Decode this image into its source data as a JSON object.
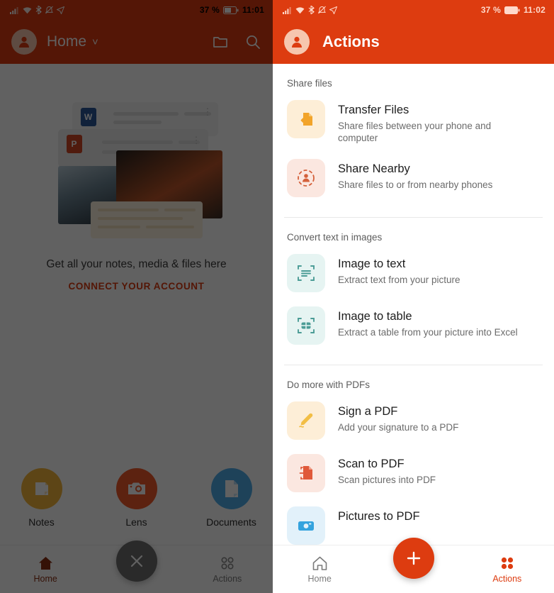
{
  "left": {
    "statusbar": {
      "battery_pct": "37 %",
      "time": "11:01",
      "icons": [
        "signal-icon",
        "wifi-icon",
        "bluetooth-icon",
        "mute-icon",
        "location-icon",
        "battery-icon"
      ]
    },
    "appbar": {
      "title": "Home",
      "chevron": "˅",
      "avatar_icon": "account-avatar-icon",
      "folder_icon": "folder-icon",
      "search_icon": "search-icon"
    },
    "empty": {
      "title": "Get all your notes, media & files here",
      "link": "CONNECT YOUR ACCOUNT",
      "illustration_icon": "files-illustration"
    },
    "quick_actions": [
      {
        "label": "Notes",
        "icon": "note-icon",
        "color": "#F5B53C"
      },
      {
        "label": "Lens",
        "icon": "camera-icon",
        "color": "#F15A2B"
      },
      {
        "label": "Documents",
        "icon": "document-icon",
        "color": "#4FADEA"
      }
    ],
    "bottomnav": {
      "home_label": "Home",
      "home_icon": "home-filled-icon",
      "actions_label": "Actions",
      "actions_icon": "grid-dots-outline-icon",
      "fab_icon": "close-icon"
    }
  },
  "right": {
    "statusbar": {
      "battery_pct": "37 %",
      "time": "11:02",
      "icons": [
        "signal-icon",
        "wifi-icon",
        "bluetooth-icon",
        "mute-icon",
        "location-icon",
        "battery-icon"
      ]
    },
    "appbar": {
      "title": "Actions",
      "avatar_icon": "account-avatar-icon"
    },
    "sections": [
      {
        "title": "Share files",
        "items": [
          {
            "title": "Transfer Files",
            "subtitle": "Share files between your phone and computer",
            "icon": "transfer-files-icon",
            "tile_bg": "#FDEED7",
            "glyph_color": "#F2A42A"
          },
          {
            "title": "Share Nearby",
            "subtitle": "Share files to or from nearby phones",
            "icon": "share-nearby-icon",
            "tile_bg": "#FBE7E0",
            "glyph_color": "#D4603A"
          }
        ]
      },
      {
        "title": "Convert text in images",
        "items": [
          {
            "title": "Image to text",
            "subtitle": "Extract text from your picture",
            "icon": "image-to-text-icon",
            "tile_bg": "#E6F4F2",
            "glyph_color": "#4B9C96"
          },
          {
            "title": "Image to table",
            "subtitle": "Extract a table from your picture into Excel",
            "icon": "image-to-table-icon",
            "tile_bg": "#E6F4F2",
            "glyph_color": "#4B9C96"
          }
        ]
      },
      {
        "title": "Do more with PDFs",
        "items": [
          {
            "title": "Sign a PDF",
            "subtitle": "Add your signature to a PDF",
            "icon": "sign-pdf-pen-icon",
            "tile_bg": "#FDEED7",
            "glyph_color": "#F2BE45"
          },
          {
            "title": "Scan to PDF",
            "subtitle": "Scan pictures into PDF",
            "icon": "scan-to-pdf-icon",
            "tile_bg": "#FBE7E0",
            "glyph_color": "#E0593A"
          },
          {
            "title": "Pictures to PDF",
            "subtitle": "",
            "icon": "pictures-to-pdf-icon",
            "tile_bg": "#E2F1FA",
            "glyph_color": "#34A3DE"
          }
        ]
      }
    ],
    "bottomnav": {
      "home_label": "Home",
      "home_icon": "home-outline-icon",
      "actions_label": "Actions",
      "actions_icon": "grid-dots-filled-icon",
      "fab_icon": "plus-icon"
    }
  },
  "theme": {
    "brand": "#DD3C10",
    "accent_amber": "#F2A42A",
    "accent_teal": "#4B9C96",
    "accent_blue": "#34A3DE"
  }
}
